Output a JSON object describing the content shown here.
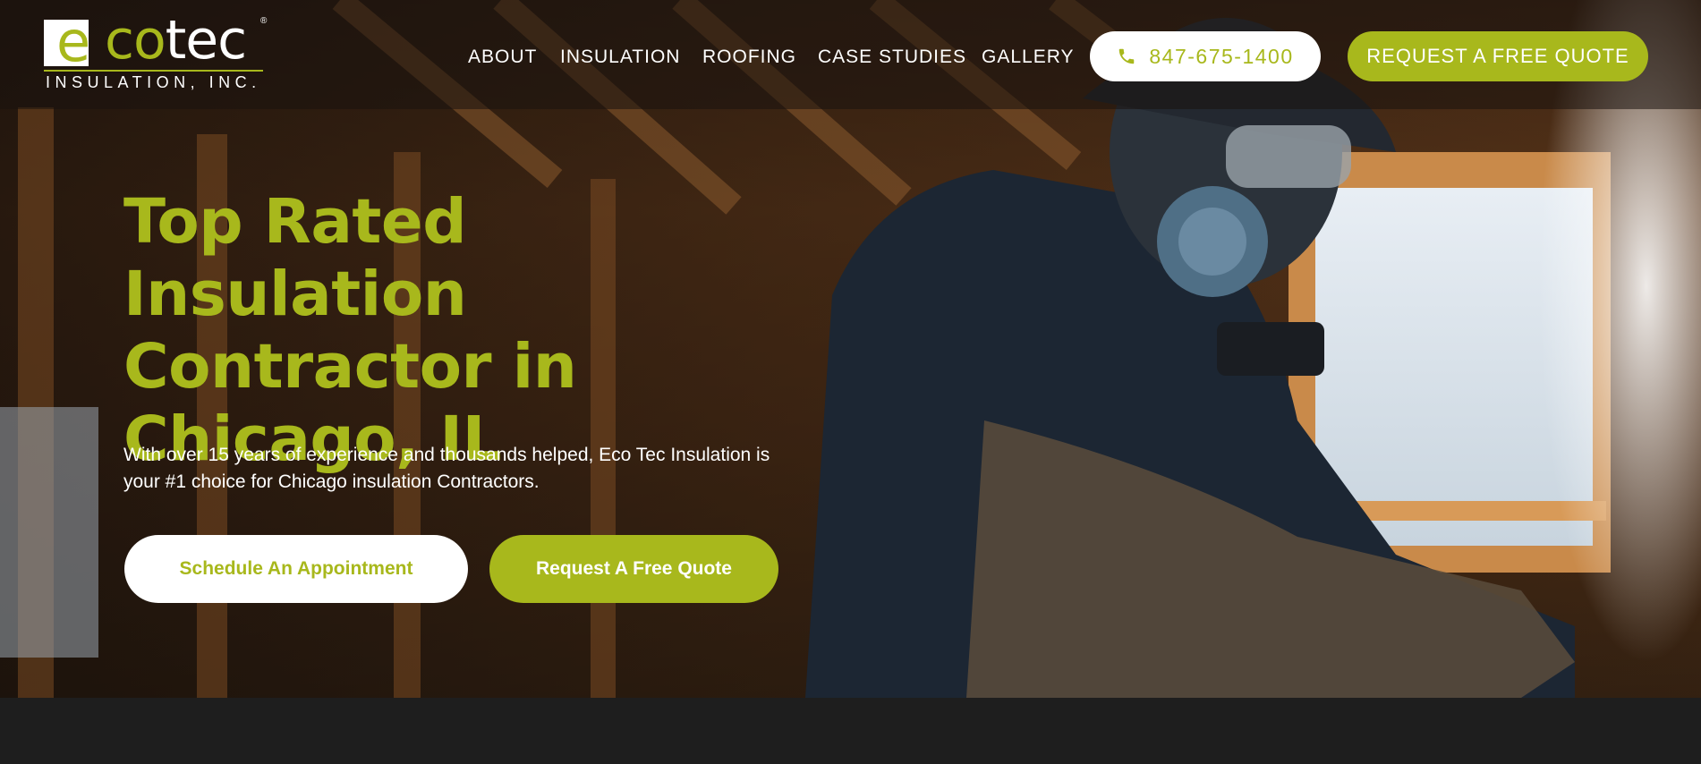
{
  "brand": {
    "logo_wordmark_e": "e",
    "logo_wordmark_co": "co",
    "logo_wordmark_tec": "tec",
    "logo_registered": "®",
    "logo_subtitle": "INSULATION, INC.",
    "accent_color": "#a8b81c"
  },
  "nav": {
    "items": [
      {
        "label": "ABOUT"
      },
      {
        "label": "INSULATION"
      },
      {
        "label": "ROOFING"
      },
      {
        "label": "CASE STUDIES"
      },
      {
        "label": "GALLERY"
      }
    ],
    "phone_icon": "phone-icon",
    "phone": "847-675-1400",
    "quote_button": "REQUEST A FREE QUOTE"
  },
  "hero": {
    "headline_line1": "Top Rated Insulation",
    "headline_line2": "Contractor in",
    "headline_line3": "Chicago, IL",
    "tagline_line1": "With over 15 years of experience and thousands helped, Eco Tec Insulation is",
    "tagline_line2": "your #1 choice for Chicago insulation Contractors.",
    "appointment_button": "Schedule An Appointment",
    "quote_button": "Request A Free Quote"
  }
}
